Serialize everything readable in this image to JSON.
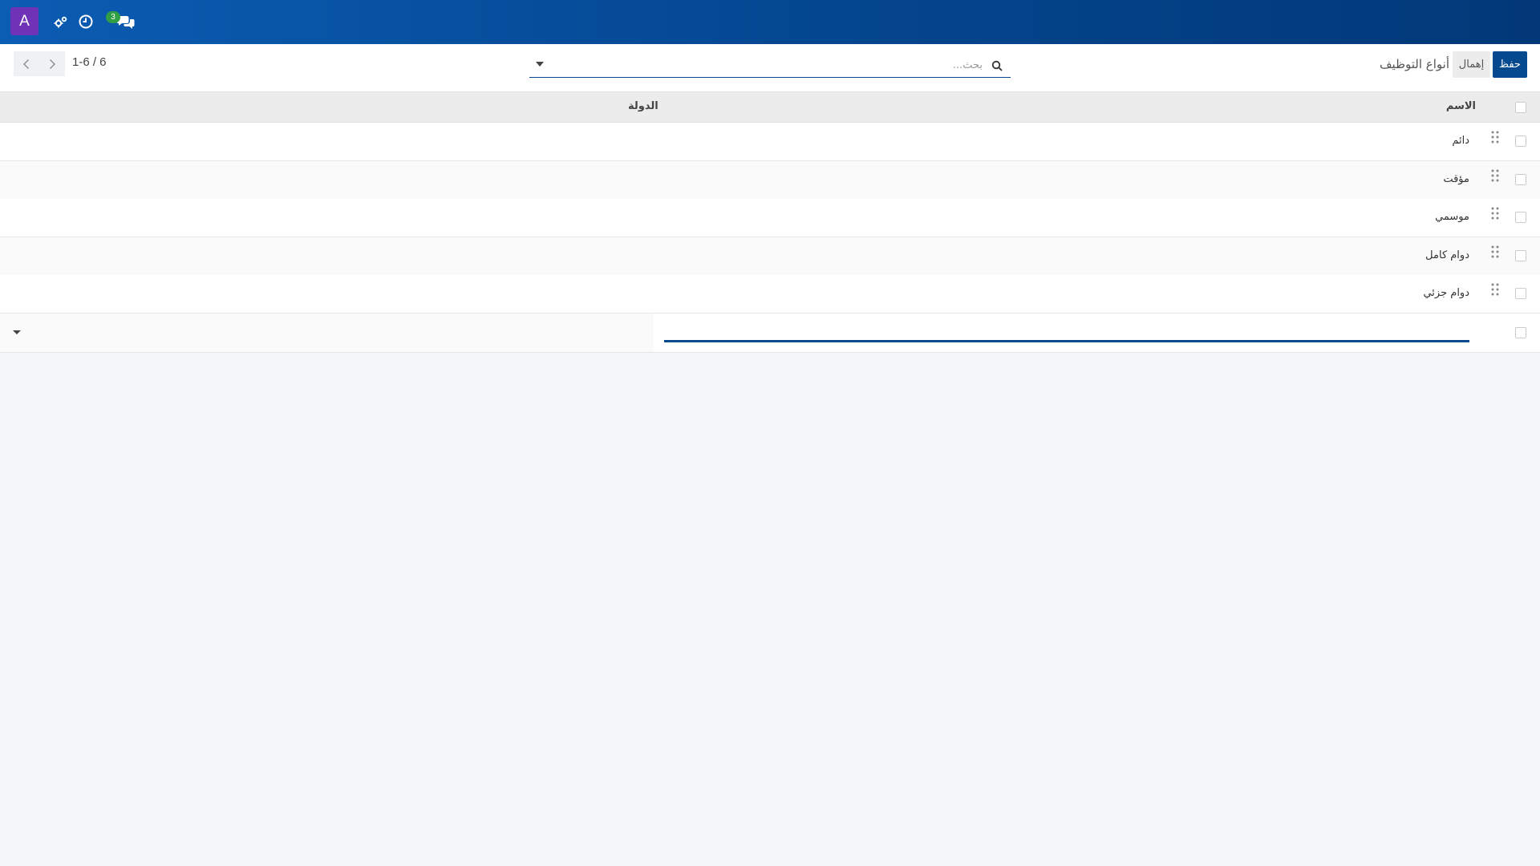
{
  "navbar": {
    "avatar_letter": "A",
    "icons": [
      "cogs-icon",
      "clock-icon",
      "chat-icon"
    ],
    "chat_badge_count": "3",
    "background_colors": [
      "#0b5cb3",
      "#023878"
    ]
  },
  "control": {
    "save_label": "حفظ",
    "discard_label": "إهمال",
    "title": "أنواع التوظيف",
    "search_placeholder": "بحث...",
    "pager_value": "1-6 / 6"
  },
  "list": {
    "columns": {
      "name": "الاسم",
      "country": "الدولة"
    },
    "rows": [
      {
        "name": "دائم"
      },
      {
        "name": "مؤقت"
      },
      {
        "name": "موسمي"
      },
      {
        "name": "دوام كامل"
      },
      {
        "name": "دوام جزئي"
      }
    ],
    "new_row": {
      "name_value": ""
    }
  },
  "colors": {
    "primary": "#05498f",
    "avatar": "#6f33b8",
    "badge": "#2f9e44"
  }
}
